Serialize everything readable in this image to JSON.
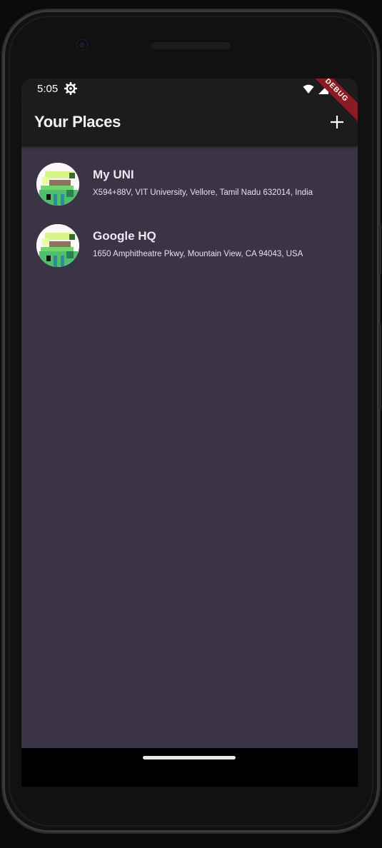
{
  "status_bar": {
    "time": "5:05",
    "icons": [
      "settings-icon",
      "wifi-icon",
      "signal-icon",
      "battery-icon"
    ]
  },
  "app_bar": {
    "title": "Your Places",
    "add_icon": "plus-icon"
  },
  "debug_banner": "DEBUG",
  "places": [
    {
      "title": "My UNI",
      "address": "X594+88V, VIT University, Vellore, Tamil Nadu 632014, India"
    },
    {
      "title": "Google HQ",
      "address": "1650 Amphitheatre Pkwy, Mountain View, CA 94043, USA"
    }
  ],
  "colors": {
    "background": "#3b3446",
    "app_bar": "#1c1c1c",
    "debug_banner": "#8b1a22"
  }
}
